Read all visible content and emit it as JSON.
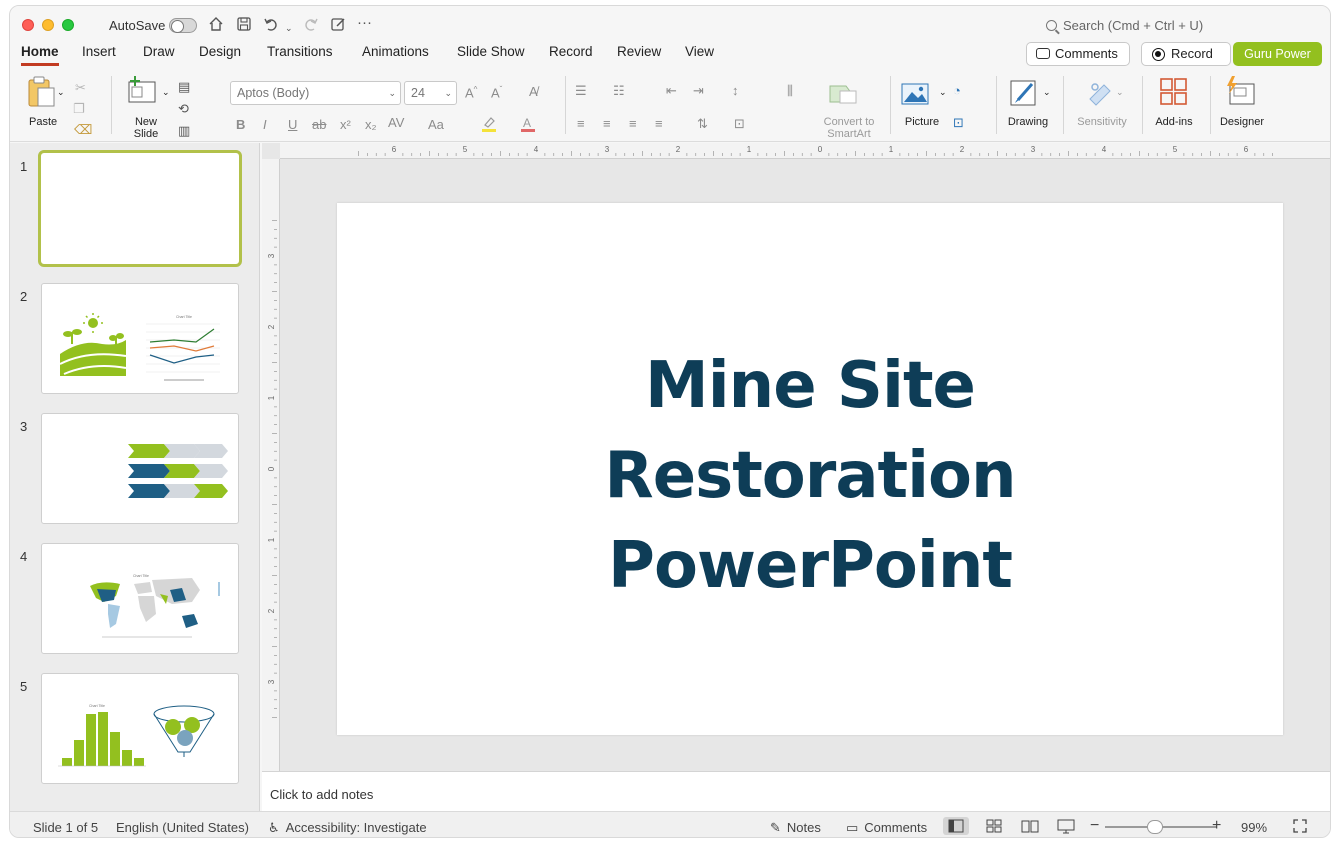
{
  "titlebar": {
    "autosave_label": "AutoSave",
    "search_placeholder": "Search (Cmd + Ctrl + U)"
  },
  "tabs": [
    {
      "label": "Home",
      "active": true
    },
    {
      "label": "Insert"
    },
    {
      "label": "Draw"
    },
    {
      "label": "Design"
    },
    {
      "label": "Transitions"
    },
    {
      "label": "Animations"
    },
    {
      "label": "Slide Show"
    },
    {
      "label": "Record"
    },
    {
      "label": "Review"
    },
    {
      "label": "View"
    }
  ],
  "header_buttons": {
    "comments": "Comments",
    "record": "Record",
    "guru": "Guru Power",
    "guru_color": "#93c01f"
  },
  "ribbon": {
    "paste": "Paste",
    "new_slide_1": "New",
    "new_slide_2": "Slide",
    "font_name": "Aptos (Body)",
    "font_size": "24",
    "smartart_1": "Convert to",
    "smartart_2": "SmartArt",
    "picture": "Picture",
    "drawing": "Drawing",
    "sensitivity": "Sensitivity",
    "addins": "Add-ins",
    "designer": "Designer"
  },
  "thumbnails": [
    {
      "num": "1"
    },
    {
      "num": "2"
    },
    {
      "num": "3"
    },
    {
      "num": "4"
    },
    {
      "num": "5"
    }
  ],
  "slide": {
    "title_line1": "Mine Site",
    "title_line2": "Restoration",
    "title_line3": "PowerPoint",
    "title_color": "#0e3d57"
  },
  "notes_placeholder": "Click to add notes",
  "status": {
    "slide_info": "Slide 1 of 5",
    "language": "English (United States)",
    "accessibility": "Accessibility: Investigate",
    "notes": "Notes",
    "comments": "Comments",
    "zoom": "99%"
  }
}
